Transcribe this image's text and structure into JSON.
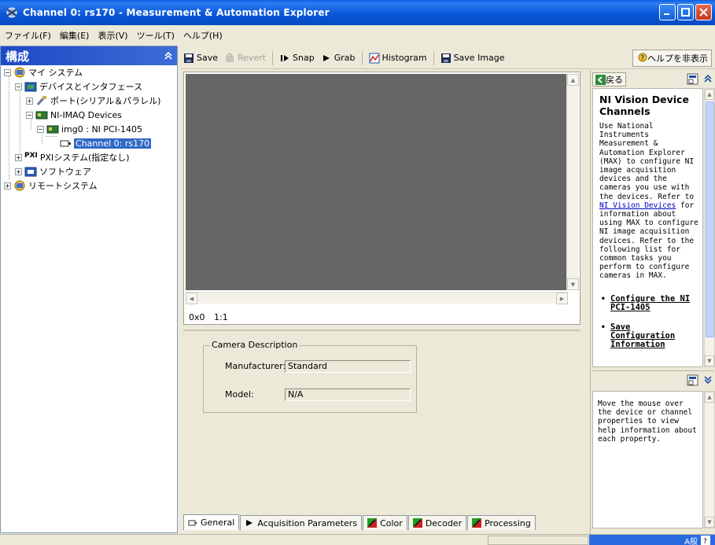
{
  "window": {
    "title": "Channel 0: rs170 - Measurement & Automation Explorer"
  },
  "menu": [
    "ファイル(F)",
    "編集(E)",
    "表示(V)",
    "ツール(T)",
    "ヘルプ(H)"
  ],
  "left_panel": {
    "title": "構成",
    "tree": {
      "my_system": "マイ システム",
      "devices_interfaces": "デバイスとインタフェース",
      "ports": "ポート(シリアル＆パラレル)",
      "ni_imaq": "NI-IMAQ Devices",
      "img0": "img0 : NI PCI-1405",
      "channel0": "Channel 0: rs170",
      "pxi": "PXIシステム(指定なし)",
      "pxi_badge": "PXI",
      "software": "ソフトウェア",
      "remote": "リモートシステム"
    }
  },
  "toolbar": {
    "save": "Save",
    "revert": "Revert",
    "snap": "Snap",
    "grab": "Grab",
    "histogram": "Histogram",
    "save_image": "Save Image",
    "hide_help": "ヘルプを非表示"
  },
  "image_view": {
    "coords": "0x0",
    "zoom": "1:1"
  },
  "camera_description": {
    "group_title": "Camera Description",
    "manufacturer_label": "Manufacturer:",
    "manufacturer_value": "Standard",
    "model_label": "Model:",
    "model_value": "N/A"
  },
  "tabs": [
    "General",
    "Acquisition Parameters",
    "Color",
    "Decoder",
    "Processing"
  ],
  "help": {
    "back": "戻る",
    "title": "NI Vision Device Channels",
    "body_before_link": "Use National Instruments Measurement & Automation Explorer (MAX) to configure NI image acquisition devices and the cameras you use with the devices. Refer to",
    "link": "NI Vision Devices",
    "body_after_link": "for information about using MAX to configure NI image acquisition devices. Refer to the following list for common tasks you perform to configure cameras in MAX.",
    "tasks": [
      "Configure the NI PCI-1405",
      "Save Configuration Information"
    ],
    "property_help": "Move the mouse over the device or channel properties to view help information about each property."
  },
  "tray": {
    "ime_text": "A般"
  }
}
